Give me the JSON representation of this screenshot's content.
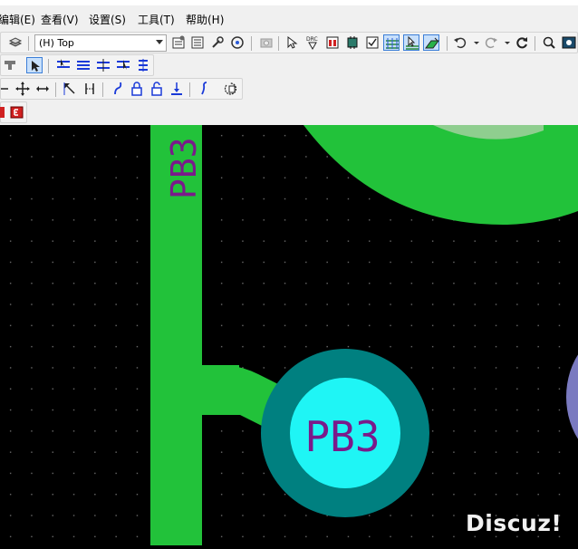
{
  "menu": {
    "items": [
      {
        "label": "编辑(E)"
      },
      {
        "label": "查看(V)"
      },
      {
        "label": "设置(S)"
      },
      {
        "label": "工具(T)"
      },
      {
        "label": "帮助(H)"
      }
    ]
  },
  "toolbar": {
    "layer_select": {
      "value": "(H) Top"
    }
  },
  "canvas": {
    "trace_color": "#22c23a",
    "background": "#000000",
    "pad_outer_color": "#008080",
    "pad_inner_color": "#1ff5f5",
    "silk_color": "#7a1a8a",
    "pad_label": "PB3",
    "vertical_silk_label": "PB3"
  },
  "watermark": {
    "text": "Discuz!"
  }
}
